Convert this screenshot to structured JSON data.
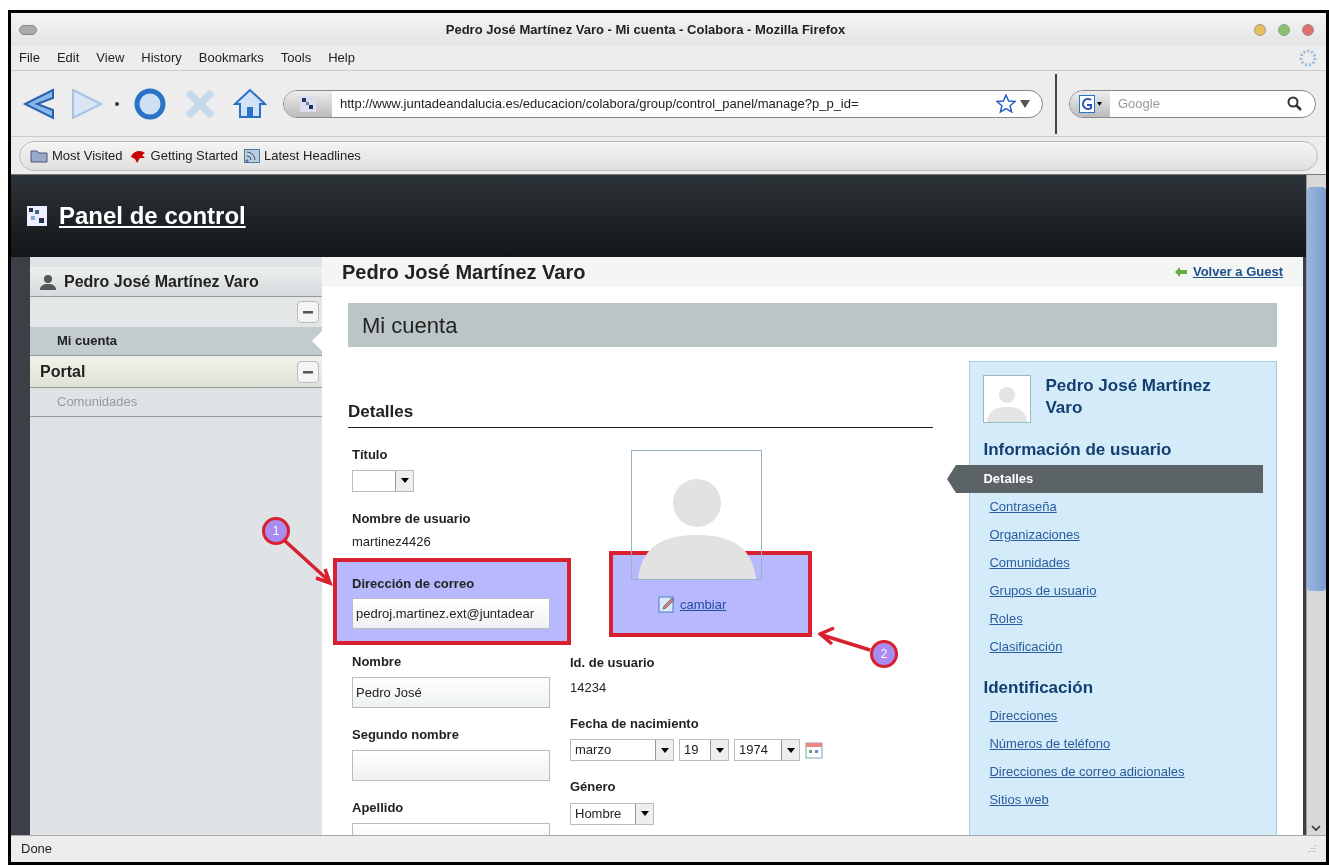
{
  "window": {
    "title": "Pedro José Martínez Varo - Mi cuenta - Colabora - Mozilla Firefox"
  },
  "menu": [
    "File",
    "Edit",
    "View",
    "History",
    "Bookmarks",
    "Tools",
    "Help"
  ],
  "toolbar": {
    "url": "http://www.juntadeandalucia.es/educacion/colabora/group/control_panel/manage?p_p_id=",
    "search_placeholder": "Google"
  },
  "bookmarks": [
    {
      "label": "Most Visited",
      "kind": "folder"
    },
    {
      "label": "Getting Started",
      "kind": "bird"
    },
    {
      "label": "Latest Headlines",
      "kind": "feed"
    }
  ],
  "page_header": {
    "title": "Panel de control"
  },
  "sidebar": [
    {
      "title": "Pedro José Martínez Varo",
      "kind": "user",
      "expanded": true,
      "items": [
        {
          "label": "Mi cuenta",
          "selected": true
        }
      ]
    },
    {
      "title": "Portal",
      "kind": "group",
      "expanded": true,
      "items": [
        {
          "label": "Comunidades",
          "selected": false
        }
      ]
    }
  ],
  "main": {
    "title": "Pedro José Martínez Varo",
    "back_link": "Volver a Guest",
    "section_title": "Mi cuenta",
    "form_heading": "Detalles",
    "left_fields": [
      {
        "kind": "select",
        "label": "Título"
      },
      {
        "kind": "text",
        "label": "Nombre de usuario",
        "value": "martinez4426"
      },
      {
        "kind": "input",
        "label": "Dirección de correo",
        "value": "pedroj.martinez.ext@juntadear",
        "highlighted": true
      },
      {
        "kind": "input",
        "label": "Nombre",
        "value": "Pedro José"
      },
      {
        "kind": "input",
        "label": "Segundo nombre"
      },
      {
        "kind": "input",
        "label": "Apellido"
      }
    ],
    "change_link": "cambiar",
    "right_fields": [
      {
        "kind": "text",
        "label": "Id. de usuario",
        "value": "14234"
      },
      {
        "kind": "date",
        "label": "Fecha de nacimiento",
        "month": "marzo",
        "day": "19",
        "year": "1974"
      },
      {
        "kind": "select",
        "label": "Género",
        "value": "Hombre"
      }
    ]
  },
  "user_panel": {
    "name": "Pedro José Martínez Varo",
    "sections": [
      {
        "title": "Información de usuario",
        "links": [
          {
            "label": "Detalles",
            "selected": true
          },
          {
            "label": "Contraseña",
            "selected": false
          },
          {
            "label": "Organizaciones",
            "selected": false
          },
          {
            "label": "Comunidades",
            "selected": false
          },
          {
            "label": "Grupos de usuario",
            "selected": false
          },
          {
            "label": "Roles",
            "selected": false
          },
          {
            "label": "Clasificación",
            "selected": false
          }
        ]
      },
      {
        "title": "Identificación",
        "links": [
          {
            "label": "Direcciones",
            "selected": false
          },
          {
            "label": "Números de teléfono",
            "selected": false
          },
          {
            "label": "Direcciones de correo adicionales",
            "selected": false
          },
          {
            "label": "Sitios web",
            "selected": false
          }
        ]
      }
    ]
  },
  "annotations": [
    {
      "number": "1"
    },
    {
      "number": "2"
    }
  ],
  "status_bar": {
    "text": "Done"
  }
}
